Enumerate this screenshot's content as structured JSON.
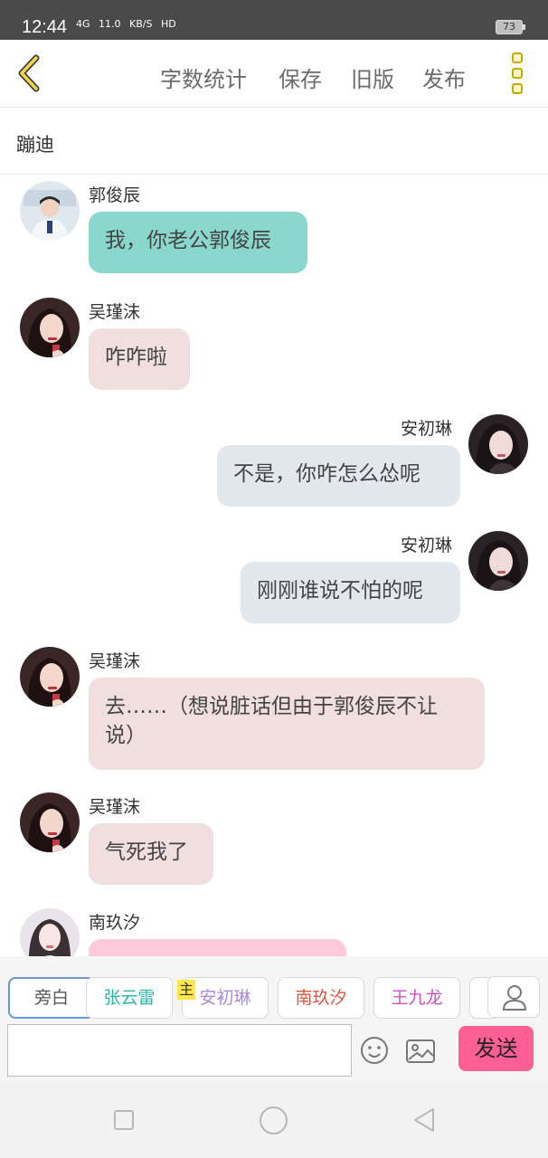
{
  "status_bar": {
    "time": "12:44",
    "network": "4G",
    "speed": "11.0",
    "speed_unit": "KB/S",
    "hd": "HD",
    "battery": "73"
  },
  "toolbar": {
    "word_count": "字数统计",
    "save": "保存",
    "old_version": "旧版",
    "publish": "发布"
  },
  "title": "蹦迪",
  "messages": [
    {
      "side": "left",
      "name": "郭俊辰",
      "text": "我，你老公郭俊辰",
      "bubble_color": "#8ad7cd",
      "avatar": "boy-avatar"
    },
    {
      "side": "left",
      "name": "吴瑾沫",
      "text": "咋咋啦",
      "bubble_color": "#f1dfe0",
      "avatar": "girl-avatar"
    },
    {
      "side": "right",
      "name": "安初琳",
      "text": "不是，你咋怎么怂呢",
      "bubble_color": "#e3e8ef",
      "avatar": "woman-avatar"
    },
    {
      "side": "right",
      "name": "安初琳",
      "text": "刚刚谁说不怕的呢",
      "bubble_color": "#e3e8ef",
      "avatar": "woman-avatar"
    },
    {
      "side": "left",
      "name": "吴瑾沫",
      "text": "去……（想说脏话但由于郭俊辰不让说）",
      "bubble_color": "#f1dfe0",
      "avatar": "girl-avatar"
    },
    {
      "side": "left",
      "name": "吴瑾沫",
      "text": "气死我了",
      "bubble_color": "#f1dfe0",
      "avatar": "girl-avatar"
    },
    {
      "side": "left",
      "name": "南玖汐",
      "text": "",
      "bubble_color": "#ffc9dc",
      "avatar": "girl2-avatar"
    }
  ],
  "roles": [
    {
      "label": "旁白",
      "color": "#555555"
    },
    {
      "label": "张云雷",
      "color": "#2bb5a7"
    },
    {
      "label": "安初琳",
      "color": "#a78ad6"
    },
    {
      "label": "南玖汐",
      "color": "#e0533f"
    },
    {
      "label": "王九龙",
      "color": "#d04fc2"
    }
  ],
  "host_tag": "主",
  "send_label": "发送",
  "colors": {
    "accent_yellow": "#c9a800",
    "send_pink": "#ff5f95"
  }
}
